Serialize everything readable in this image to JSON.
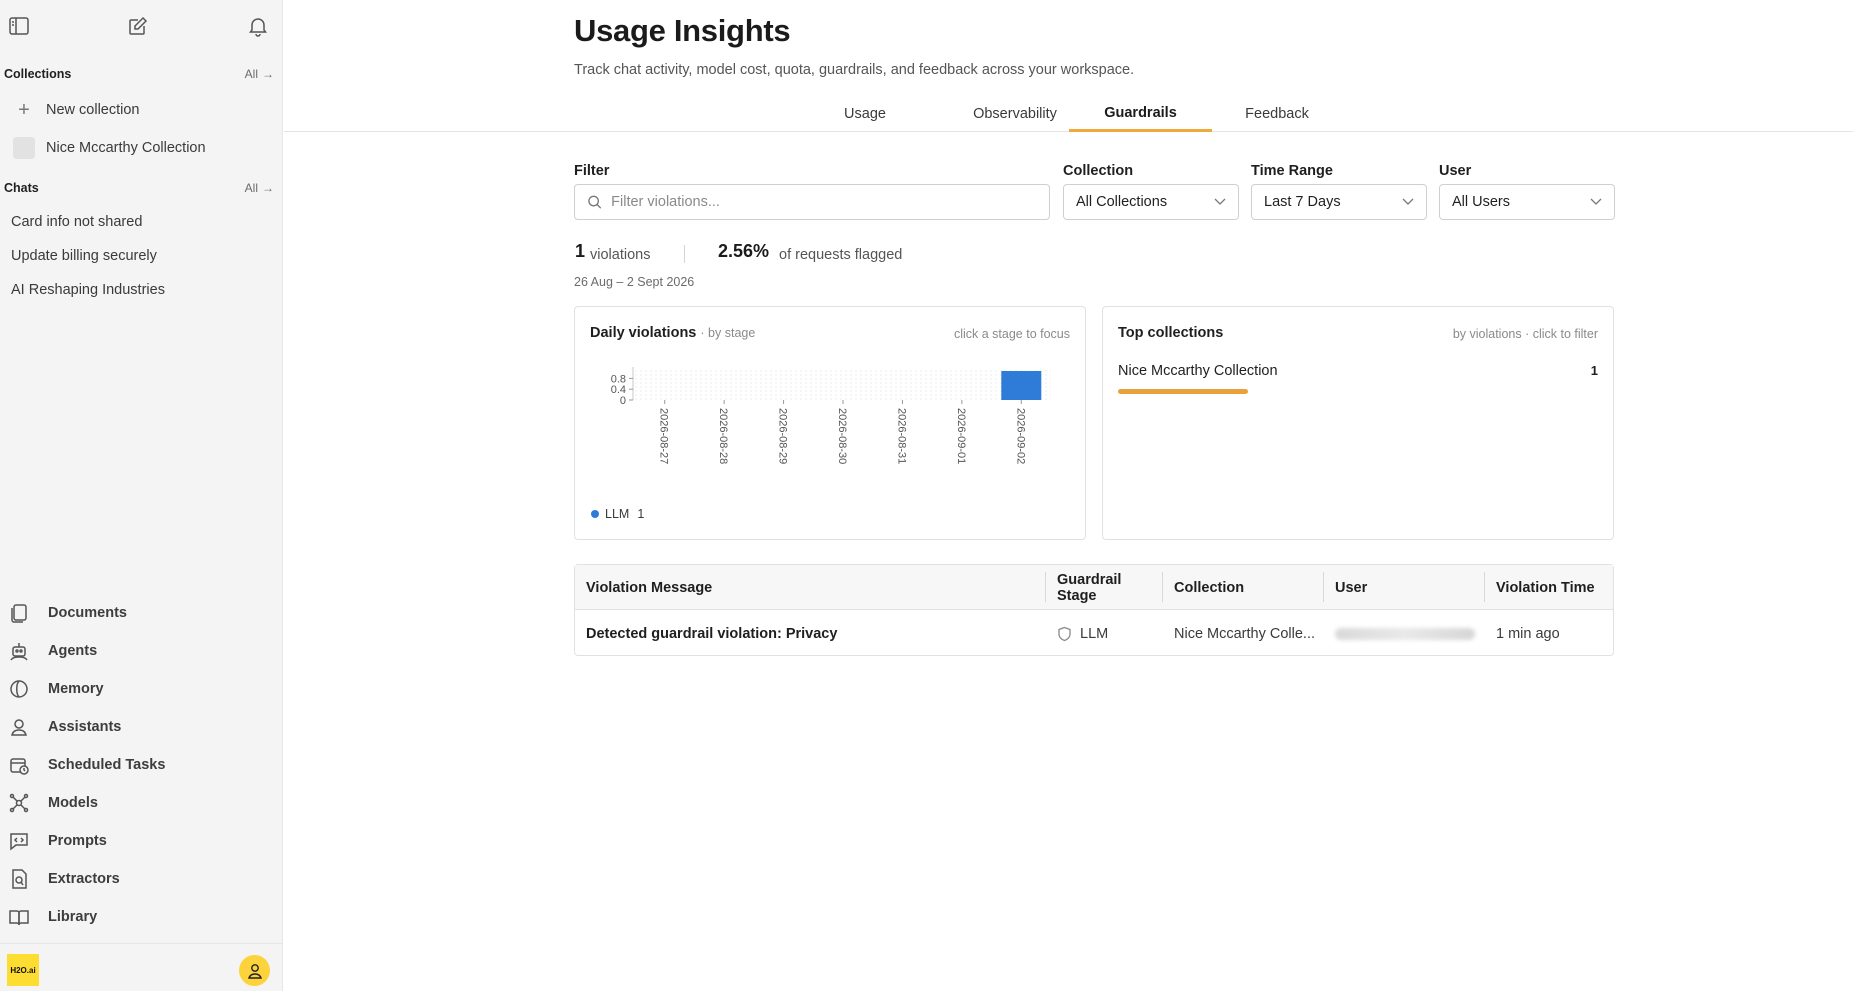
{
  "sidebar": {
    "collections_heading": "Collections",
    "collections_all": "All",
    "new_collection": "New collection",
    "collections": [
      "Nice Mccarthy Collection"
    ],
    "chats_heading": "Chats",
    "chats_all": "All",
    "chats": [
      "Card info not shared",
      "Update billing securely",
      "AI Reshaping Industries"
    ],
    "nav": [
      {
        "label": "Documents",
        "icon": "documents-icon"
      },
      {
        "label": "Agents",
        "icon": "agents-icon"
      },
      {
        "label": "Memory",
        "icon": "memory-icon"
      },
      {
        "label": "Assistants",
        "icon": "assistants-icon"
      },
      {
        "label": "Scheduled Tasks",
        "icon": "scheduled-tasks-icon"
      },
      {
        "label": "Models",
        "icon": "models-icon"
      },
      {
        "label": "Prompts",
        "icon": "prompts-icon"
      },
      {
        "label": "Extractors",
        "icon": "extractors-icon"
      },
      {
        "label": "Library",
        "icon": "library-icon"
      }
    ],
    "logo_text": "H2O.ai"
  },
  "page": {
    "title": "Usage Insights",
    "subtitle": "Track chat activity, model cost, quota, guardrails, and feedback across your workspace."
  },
  "tabs": [
    {
      "label": "Usage",
      "active": false
    },
    {
      "label": "Observability",
      "active": false
    },
    {
      "label": "Guardrails",
      "active": true
    },
    {
      "label": "Feedback",
      "active": false
    }
  ],
  "filters": {
    "filter_label": "Filter",
    "filter_placeholder": "Filter violations...",
    "collection_label": "Collection",
    "collection_value": "All Collections",
    "time_label": "Time Range",
    "time_value": "Last 7 Days",
    "user_label": "User",
    "user_value": "All Users"
  },
  "stats": {
    "violations_count": "1",
    "violations_label": "violations",
    "flagged_pct": "2.56%",
    "flagged_label": "of requests flagged",
    "date_range": "26 Aug – 2 Sept 2026"
  },
  "daily_card": {
    "title": "Daily violations",
    "subtitle": "· by stage",
    "hint": "click a stage to focus",
    "legend_label": "LLM",
    "legend_value": "1"
  },
  "chart_data": {
    "type": "bar",
    "categories": [
      "2026-08-27",
      "2026-08-28",
      "2026-08-29",
      "2026-08-30",
      "2026-08-31",
      "2026-09-01",
      "2026-09-02"
    ],
    "series": [
      {
        "name": "LLM",
        "values": [
          0,
          0,
          0,
          0,
          0,
          0,
          1
        ]
      }
    ],
    "yticks": [
      "0.8",
      "0.4",
      "0"
    ],
    "ylim": [
      0,
      1
    ],
    "color": "#2f7bd8"
  },
  "top_card": {
    "title": "Top collections",
    "hint": "by violations · click to filter",
    "items": [
      {
        "name": "Nice Mccarthy Collection",
        "count": "1",
        "share": 0.27
      }
    ],
    "bar_color": "#e9a23b"
  },
  "table": {
    "headers": [
      "Violation Message",
      "Guardrail Stage",
      "Collection",
      "User",
      "Violation Time"
    ],
    "rows": [
      {
        "message": "Detected guardrail violation: Privacy",
        "stage": "LLM",
        "collection": "Nice Mccarthy Colle...",
        "time": "1 min ago"
      }
    ]
  }
}
